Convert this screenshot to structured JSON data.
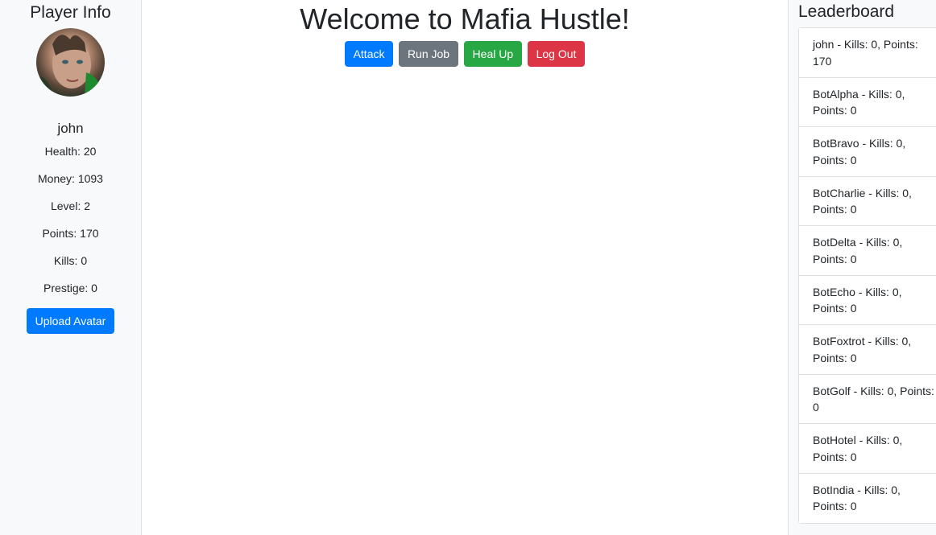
{
  "sidebar": {
    "heading": "Player Info",
    "player_name": "john",
    "stats": [
      "Health: 20",
      "Money: 1093",
      "Level: 2",
      "Points: 170",
      "Kills: 0",
      "Prestige: 0"
    ],
    "upload_label": "Upload Avatar"
  },
  "main": {
    "title": "Welcome to Mafia Hustle!",
    "actions": {
      "attack": "Attack",
      "run_job": "Run Job",
      "heal_up": "Heal Up",
      "log_out": "Log Out"
    }
  },
  "leaderboard": {
    "heading": "Leaderboard",
    "entries": [
      "john - Kills: 0, Points: 170",
      "BotAlpha - Kills: 0, Points: 0",
      "BotBravo - Kills: 0, Points: 0",
      "BotCharlie - Kills: 0, Points: 0",
      "BotDelta - Kills: 0, Points: 0",
      "BotEcho - Kills: 0, Points: 0",
      "BotFoxtrot - Kills: 0, Points: 0",
      "BotGolf - Kills: 0, Points: 0",
      "BotHotel - Kills: 0, Points: 0",
      "BotIndia - Kills: 0, Points: 0"
    ]
  },
  "colors": {
    "primary": "#007bff",
    "secondary": "#6c757d",
    "success": "#28a745",
    "danger": "#dc3545",
    "panel_bg": "#f8f9fa"
  }
}
